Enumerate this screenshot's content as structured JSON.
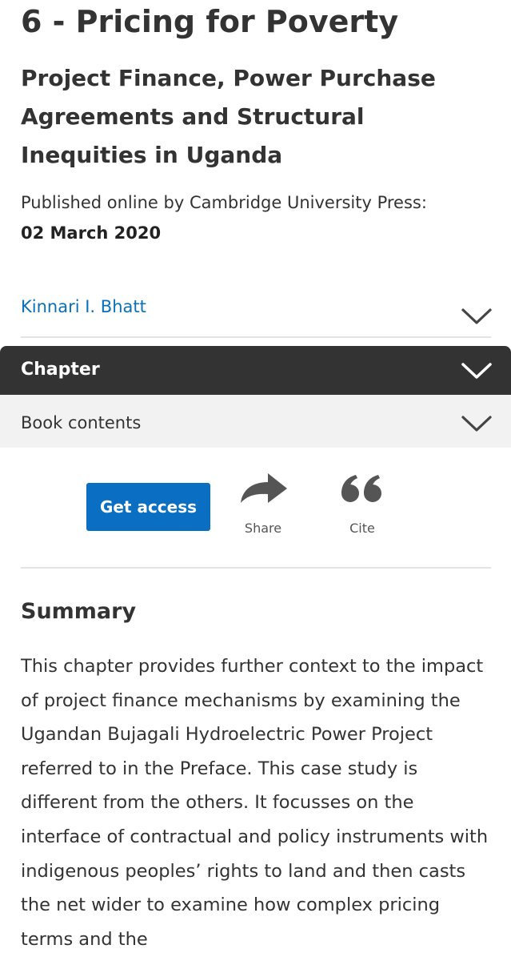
{
  "chapter": {
    "title": "6 - Pricing for Poverty",
    "subtitle": "Project Finance, Power Purchase Agreements and Structural Inequities in Uganda",
    "published_label": "Published online by Cambridge University Press:",
    "published_date": "02 March 2020"
  },
  "author": {
    "name": "Kinnari I. Bhatt",
    "expand_icon": "chevron-down-icon"
  },
  "accordions": {
    "chapter_label": "Chapter",
    "book_contents_label": "Book contents"
  },
  "actions": {
    "get_access_label": "Get access",
    "share_label": "Share",
    "share_icon": "share-arrow-icon",
    "cite_label": "Cite",
    "cite_icon": "quote-icon"
  },
  "summary": {
    "heading": "Summary",
    "text": "This chapter provides further context to the impact of project finance mechanisms by examining the Ugandan Bujagali Hydroelectric Power Project referred to in the Preface. This case study is different from the others. It focusses on the interface of contractual and policy instruments with indigenous peoples’ rights to land and then casts the net wider to examine how complex pricing terms and the"
  },
  "colors": {
    "link": "#0a70b8",
    "button": "#0a6fc2",
    "dark_bar": "#333333",
    "light_bar": "#f2f2f2"
  }
}
